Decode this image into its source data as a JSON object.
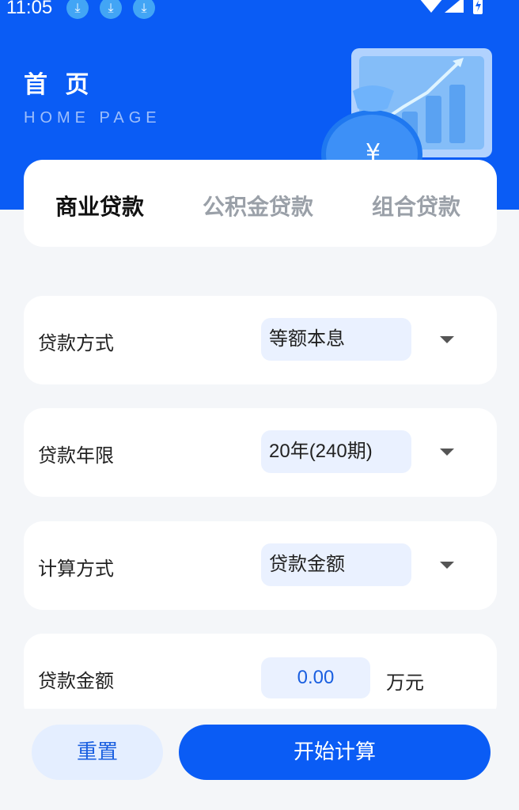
{
  "status_bar": {
    "time": "11:05",
    "icons": [
      "download-icon",
      "download-icon",
      "download-icon",
      "wifi-icon",
      "signal-icon",
      "battery-icon"
    ]
  },
  "header": {
    "title": "首 页",
    "subtitle": "HOME PAGE",
    "illustration": "money-bag-chart-illustration"
  },
  "tabs": [
    {
      "label": "商业贷款",
      "active": true
    },
    {
      "label": "公积金贷款",
      "active": false
    },
    {
      "label": "组合贷款",
      "active": false
    }
  ],
  "form": {
    "loan_method": {
      "label": "贷款方式",
      "value": "等额本息"
    },
    "loan_term": {
      "label": "贷款年限",
      "value": "20年(240期)"
    },
    "calc_method": {
      "label": "计算方式",
      "value": "贷款金额"
    },
    "loan_amount": {
      "label": "贷款金额",
      "value": "0.00",
      "unit": "万元"
    }
  },
  "actions": {
    "reset": "重置",
    "calculate": "开始计算"
  },
  "colors": {
    "primary": "#0a5cf5",
    "input_bg": "#eaf1ff",
    "page_bg": "#f4f6f9"
  }
}
